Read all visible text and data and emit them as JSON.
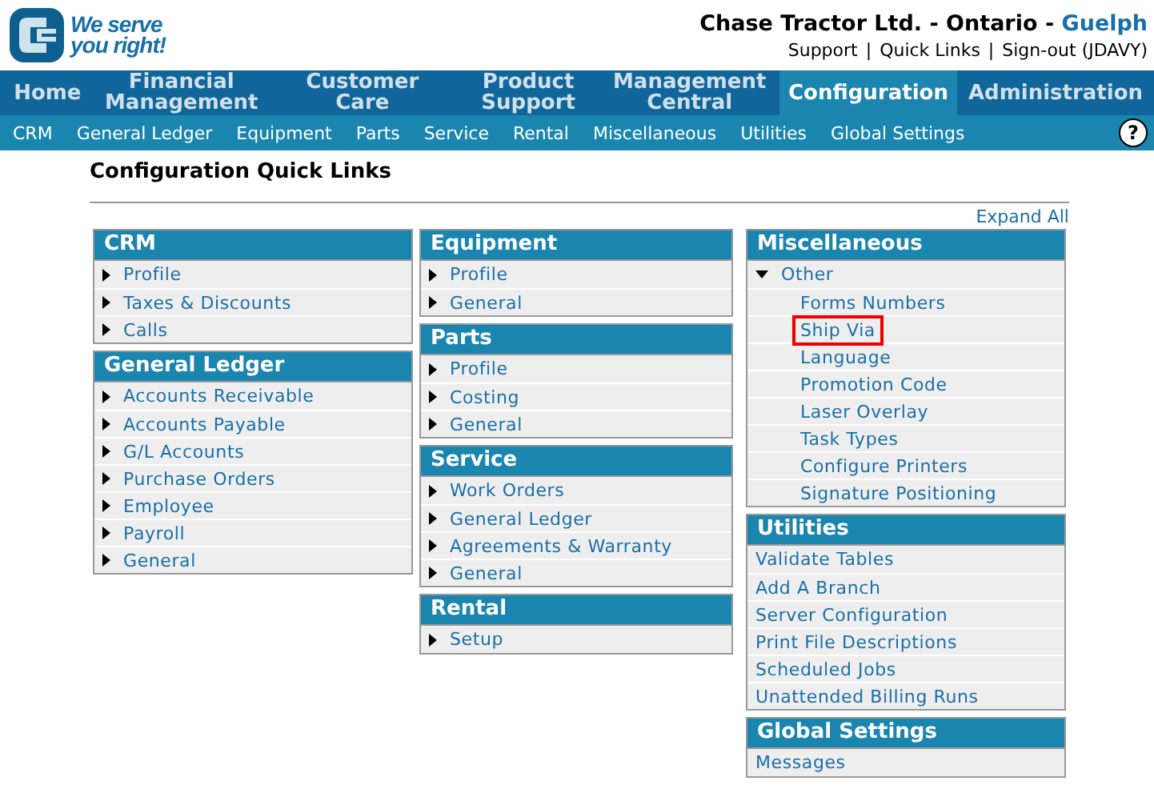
{
  "logo": {
    "slogan_line_1": "We serve",
    "slogan_line_2": "you right!"
  },
  "header": {
    "title": "Chase Tractor Ltd. - Ontario -",
    "branch": "Guelph",
    "separator": "|",
    "links": [
      "Support",
      "Quick Links",
      "Sign-out (JDAVY)"
    ]
  },
  "main_nav": [
    {
      "label": "Home",
      "selected": false
    },
    {
      "label": "Financial Management",
      "selected": false
    },
    {
      "label": "Customer Care",
      "selected": false
    },
    {
      "label": "Product Support",
      "selected": false
    },
    {
      "label": "Management Central",
      "selected": false
    },
    {
      "label": "Configuration",
      "selected": true
    },
    {
      "label": "Administration",
      "selected": false
    }
  ],
  "sub_nav": [
    "CRM",
    "General Ledger",
    "Equipment",
    "Parts",
    "Service",
    "Rental",
    "Miscellaneous",
    "Utilities",
    "Global Settings"
  ],
  "help": "?",
  "page_title": "Configuration Quick Links",
  "expand_all": "Expand All",
  "columns": [
    [
      {
        "title": "CRM",
        "items": [
          {
            "kind": "link",
            "label": "Profile"
          },
          {
            "kind": "link",
            "label": "Taxes & Discounts"
          },
          {
            "kind": "link",
            "label": "Calls"
          }
        ]
      },
      {
        "title": "General Ledger",
        "items": [
          {
            "kind": "link",
            "label": "Accounts Receivable"
          },
          {
            "kind": "link",
            "label": "Accounts Payable"
          },
          {
            "kind": "link",
            "label": "G/L Accounts"
          },
          {
            "kind": "link",
            "label": "Purchase Orders"
          },
          {
            "kind": "link",
            "label": "Employee"
          },
          {
            "kind": "link",
            "label": "Payroll"
          },
          {
            "kind": "link",
            "label": "General"
          }
        ]
      }
    ],
    [
      {
        "title": "Equipment",
        "items": [
          {
            "kind": "link",
            "label": "Profile"
          },
          {
            "kind": "link",
            "label": "General"
          }
        ]
      },
      {
        "title": "Parts",
        "items": [
          {
            "kind": "link",
            "label": "Profile"
          },
          {
            "kind": "link",
            "label": "Costing"
          },
          {
            "kind": "link",
            "label": "General"
          }
        ]
      },
      {
        "title": "Service",
        "items": [
          {
            "kind": "link",
            "label": "Work Orders"
          },
          {
            "kind": "link",
            "label": "General Ledger"
          },
          {
            "kind": "link",
            "label": "Agreements & Warranty"
          },
          {
            "kind": "link",
            "label": "General"
          }
        ]
      },
      {
        "title": "Rental",
        "items": [
          {
            "kind": "link",
            "label": "Setup"
          }
        ]
      }
    ],
    [
      {
        "title": "Miscellaneous",
        "items": [
          {
            "kind": "group",
            "label": "Other",
            "expanded": true,
            "children": [
              {
                "label": "Forms Numbers",
                "highlighted": false
              },
              {
                "label": "Ship Via",
                "highlighted": true
              },
              {
                "label": "Language",
                "highlighted": false
              },
              {
                "label": "Promotion Code",
                "highlighted": false
              },
              {
                "label": "Laser Overlay",
                "highlighted": false
              },
              {
                "label": "Task Types",
                "highlighted": false
              },
              {
                "label": "Configure Printers",
                "highlighted": false
              },
              {
                "label": "Signature Positioning",
                "highlighted": false
              }
            ]
          }
        ]
      },
      {
        "title": "Utilities",
        "items": [
          {
            "kind": "plain",
            "label": "Validate Tables"
          },
          {
            "kind": "plain",
            "label": "Add A Branch"
          },
          {
            "kind": "plain",
            "label": "Server Configuration"
          },
          {
            "kind": "plain",
            "label": "Print File Descriptions"
          },
          {
            "kind": "plain",
            "label": "Scheduled Jobs"
          },
          {
            "kind": "plain",
            "label": "Unattended Billing Runs"
          }
        ]
      },
      {
        "title": "Global Settings",
        "items": [
          {
            "kind": "plain",
            "label": "Messages"
          }
        ]
      }
    ]
  ]
}
